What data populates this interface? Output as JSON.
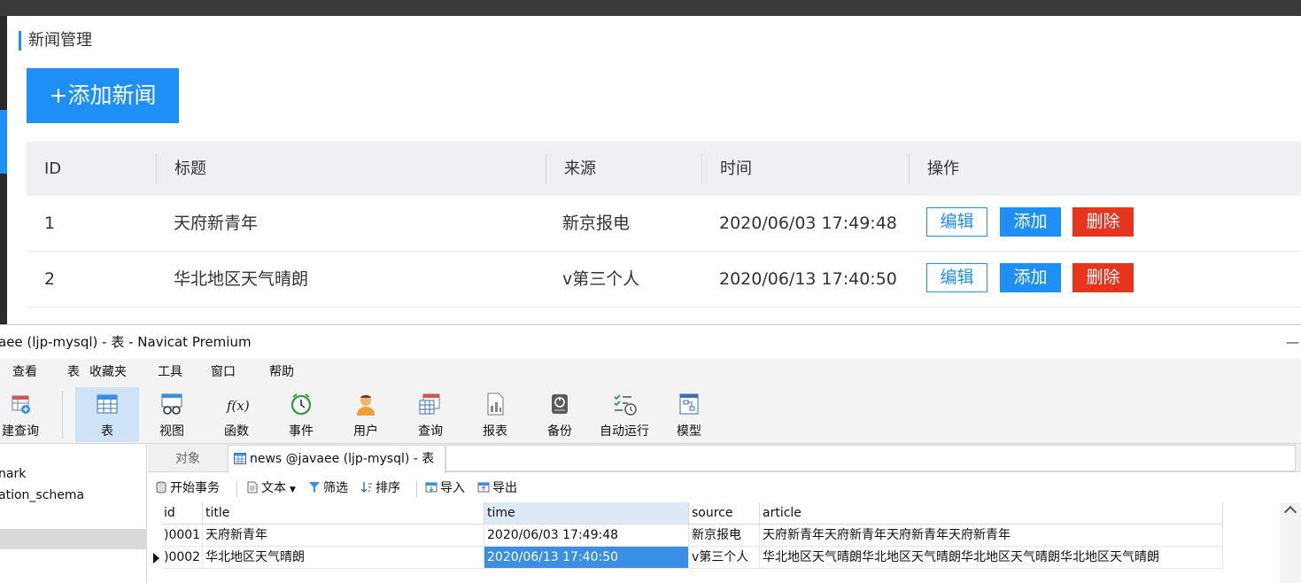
{
  "web": {
    "breadcrumb": "新闻管理",
    "add_button": "+添加新闻",
    "columns": [
      "ID",
      "标题",
      "来源",
      "时间",
      "操作"
    ],
    "rows": [
      {
        "id": "1",
        "title": "天府新青年",
        "source": "新京报电",
        "time": "2020/06/03 17:49:48"
      },
      {
        "id": "2",
        "title": "华北地区天气晴朗",
        "source": "v第三个人",
        "time": "2020/06/13 17:40:50"
      }
    ],
    "actions": {
      "edit": "编辑",
      "add": "添加",
      "delete": "删除"
    },
    "colors": {
      "primary": "#1e8ff7",
      "danger": "#e8341c",
      "header_bg": "#eef0f3"
    }
  },
  "navicat": {
    "window_title": "aee (ljp-mysql) - 表 - Navicat Premium",
    "minimize": "—",
    "menu": [
      "查看",
      "表",
      "收藏夹",
      "工具",
      "窗口",
      "帮助"
    ],
    "toolbar": [
      {
        "label": "建查询",
        "icon": "new-query-icon"
      },
      {
        "label": "表",
        "icon": "table-icon"
      },
      {
        "label": "视图",
        "icon": "view-icon"
      },
      {
        "label": "函数",
        "icon": "function-icon"
      },
      {
        "label": "事件",
        "icon": "event-clock-icon"
      },
      {
        "label": "用户",
        "icon": "user-icon"
      },
      {
        "label": "查询",
        "icon": "query-icon"
      },
      {
        "label": "报表",
        "icon": "report-icon"
      },
      {
        "label": "备份",
        "icon": "backup-icon"
      },
      {
        "label": "自动运行",
        "icon": "automation-icon"
      },
      {
        "label": "模型",
        "icon": "model-icon"
      }
    ],
    "function_glyph": "f(x)",
    "sidebar": [
      "nark",
      "ation_schema"
    ],
    "tabs": {
      "objects": "对象",
      "news": "news @javaee (ljp-mysql) - 表"
    },
    "subtoolbar": {
      "begin_tx": "开始事务",
      "text": "文本",
      "filter": "筛选",
      "sort": "排序",
      "import": "导入",
      "export": "导出"
    },
    "grid": {
      "columns": [
        "id",
        "title",
        "time",
        "source",
        "article"
      ],
      "rows": [
        {
          "id": ")0001",
          "title": "天府新青年",
          "time": "2020/06/03 17:49:48",
          "source": "新京报电",
          "article": "天府新青年天府新青年天府新青年天府新青年"
        },
        {
          "id": ")0002",
          "title": "华北地区天气晴朗",
          "time": "2020/06/13 17:40:50",
          "source": "v第三个人",
          "article": "华北地区天气晴朗华北地区天气晴朗华北地区天气晴朗华北地区天气晴朗"
        }
      ]
    }
  }
}
